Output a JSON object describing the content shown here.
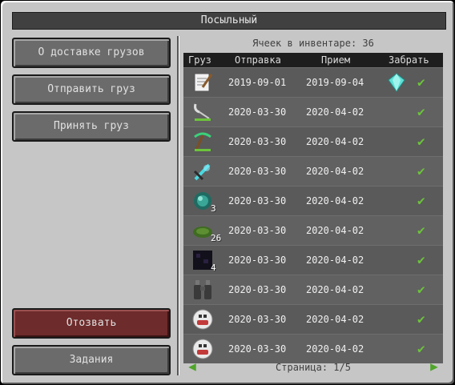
{
  "window": {
    "title": "Посыльный"
  },
  "sidebar": {
    "buttons": [
      {
        "label": "О доставке грузов"
      },
      {
        "label": "Отправить груз"
      },
      {
        "label": "Принять груз"
      }
    ],
    "recall_label": "Отозвать",
    "tasks_label": "Задания"
  },
  "inventory": {
    "cells_text": "Ячеек в инвентаре: 36"
  },
  "table": {
    "headers": {
      "cargo": "Груз",
      "sent": "Отправка",
      "received": "Прием",
      "claim": "Забрать"
    },
    "rows": [
      {
        "icon": "book-and-quill-icon",
        "count": "",
        "sent": "2019-09-01",
        "received": "2019-09-04",
        "claim_icon": "diamond-icon"
      },
      {
        "icon": "shears-icon",
        "count": "",
        "sent": "2020-03-30",
        "received": "2020-04-02",
        "claim_icon": ""
      },
      {
        "icon": "emerald-pickaxe-icon",
        "count": "",
        "sent": "2020-03-30",
        "received": "2020-04-02",
        "claim_icon": ""
      },
      {
        "icon": "enchanted-sword-icon",
        "count": "",
        "sent": "2020-03-30",
        "received": "2020-04-02",
        "claim_icon": ""
      },
      {
        "icon": "ender-pearl-icon",
        "count": "3",
        "sent": "2020-03-30",
        "received": "2020-04-02",
        "claim_icon": ""
      },
      {
        "icon": "lily-pad-icon",
        "count": "26",
        "sent": "2020-03-30",
        "received": "2020-04-02",
        "claim_icon": ""
      },
      {
        "icon": "obsidian-block-icon",
        "count": "4",
        "sent": "2020-03-30",
        "received": "2020-04-02",
        "claim_icon": ""
      },
      {
        "icon": "binoculars-icon",
        "count": "",
        "sent": "2020-03-30",
        "received": "2020-04-02",
        "claim_icon": ""
      },
      {
        "icon": "skull-mask-icon",
        "count": "",
        "sent": "2020-03-30",
        "received": "2020-04-02",
        "claim_icon": ""
      },
      {
        "icon": "skull-mask-icon",
        "count": "",
        "sent": "2020-03-30",
        "received": "2020-04-02",
        "claim_icon": ""
      }
    ],
    "check_glyph": "✔"
  },
  "pagination": {
    "text": "Страница: 1/5",
    "prev_glyph": "◀",
    "next_glyph": "▶"
  },
  "colors": {
    "check": "#6cc33b",
    "arrow": "#4fa52a",
    "recall_button": "#6d2b2b"
  }
}
